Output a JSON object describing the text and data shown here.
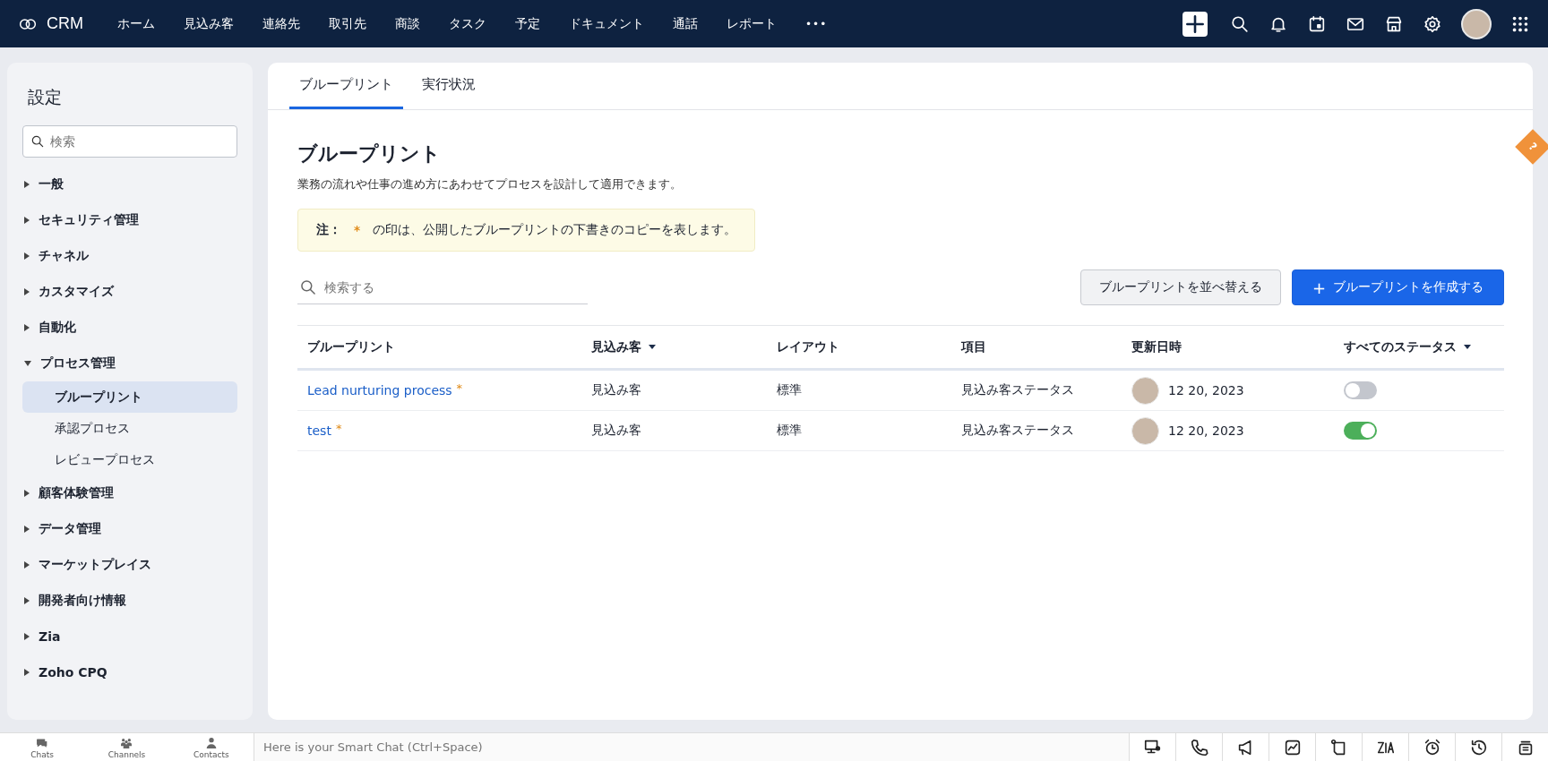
{
  "topbar": {
    "brand": "CRM",
    "nav": [
      {
        "label": "ホーム"
      },
      {
        "label": "見込み客"
      },
      {
        "label": "連絡先"
      },
      {
        "label": "取引先"
      },
      {
        "label": "商談"
      },
      {
        "label": "タスク"
      },
      {
        "label": "予定"
      },
      {
        "label": "ドキュメント"
      },
      {
        "label": "通話"
      },
      {
        "label": "レポート"
      }
    ],
    "more": "•••"
  },
  "sidebar": {
    "title": "設定",
    "search": {
      "placeholder": "検索"
    },
    "items": [
      {
        "label": "一般",
        "expanded": false
      },
      {
        "label": "セキュリティ管理",
        "expanded": false
      },
      {
        "label": "チャネル",
        "expanded": false
      },
      {
        "label": "カスタマイズ",
        "expanded": false
      },
      {
        "label": "自動化",
        "expanded": false
      },
      {
        "label": "プロセス管理",
        "expanded": true,
        "children": [
          {
            "label": "ブループリント",
            "selected": true
          },
          {
            "label": "承認プロセス",
            "selected": false
          },
          {
            "label": "レビュープロセス",
            "selected": false
          }
        ]
      },
      {
        "label": "顧客体験管理",
        "expanded": false
      },
      {
        "label": "データ管理",
        "expanded": false
      },
      {
        "label": "マーケットプレイス",
        "expanded": false
      },
      {
        "label": "開発者向け情報",
        "expanded": false
      },
      {
        "label": "Zia",
        "expanded": false
      },
      {
        "label": "Zoho CPQ",
        "expanded": false
      }
    ]
  },
  "tabs": [
    {
      "label": "ブループリント",
      "selected": true
    },
    {
      "label": "実行状況",
      "selected": false
    }
  ],
  "page": {
    "heading": "ブループリント",
    "description": "業務の流れや仕事の進め方にあわせてプロセスを設計して適用できます。",
    "note": {
      "label": "注：",
      "mark": "*",
      "text": "の印は、公開したブループリントの下書きのコピーを表します。"
    },
    "search": {
      "placeholder": "検索する"
    },
    "buttons": [
      {
        "label": "ブループリントを並べ替える",
        "kind": "secondary"
      },
      {
        "label": "ブループリントを作成する",
        "kind": "primary",
        "icon": "+"
      }
    ],
    "help": "?"
  },
  "table": {
    "columns": [
      {
        "label": "ブループリント",
        "dropdown": false
      },
      {
        "label": "見込み客",
        "dropdown": true
      },
      {
        "label": "レイアウト",
        "dropdown": false
      },
      {
        "label": "項目",
        "dropdown": false
      },
      {
        "label": "更新日時",
        "dropdown": false
      },
      {
        "label": "すべてのステータス",
        "dropdown": true
      }
    ],
    "rows": [
      {
        "name": "Lead nurturing process",
        "mark": "*",
        "module": "見込み客",
        "layout": "標準",
        "field": "見込み客ステータス",
        "date": "12 20, 2023",
        "enabled": false
      },
      {
        "name": "test",
        "mark": "*",
        "module": "見込み客",
        "layout": "標準",
        "field": "見込み客ステータス",
        "date": "12 20, 2023",
        "enabled": true
      }
    ]
  },
  "bottombar": {
    "tabs": [
      {
        "label": "Chats"
      },
      {
        "label": "Channels"
      },
      {
        "label": "Contacts"
      }
    ],
    "chat": {
      "placeholder": "Here is your Smart Chat (Ctrl+Space)"
    }
  }
}
